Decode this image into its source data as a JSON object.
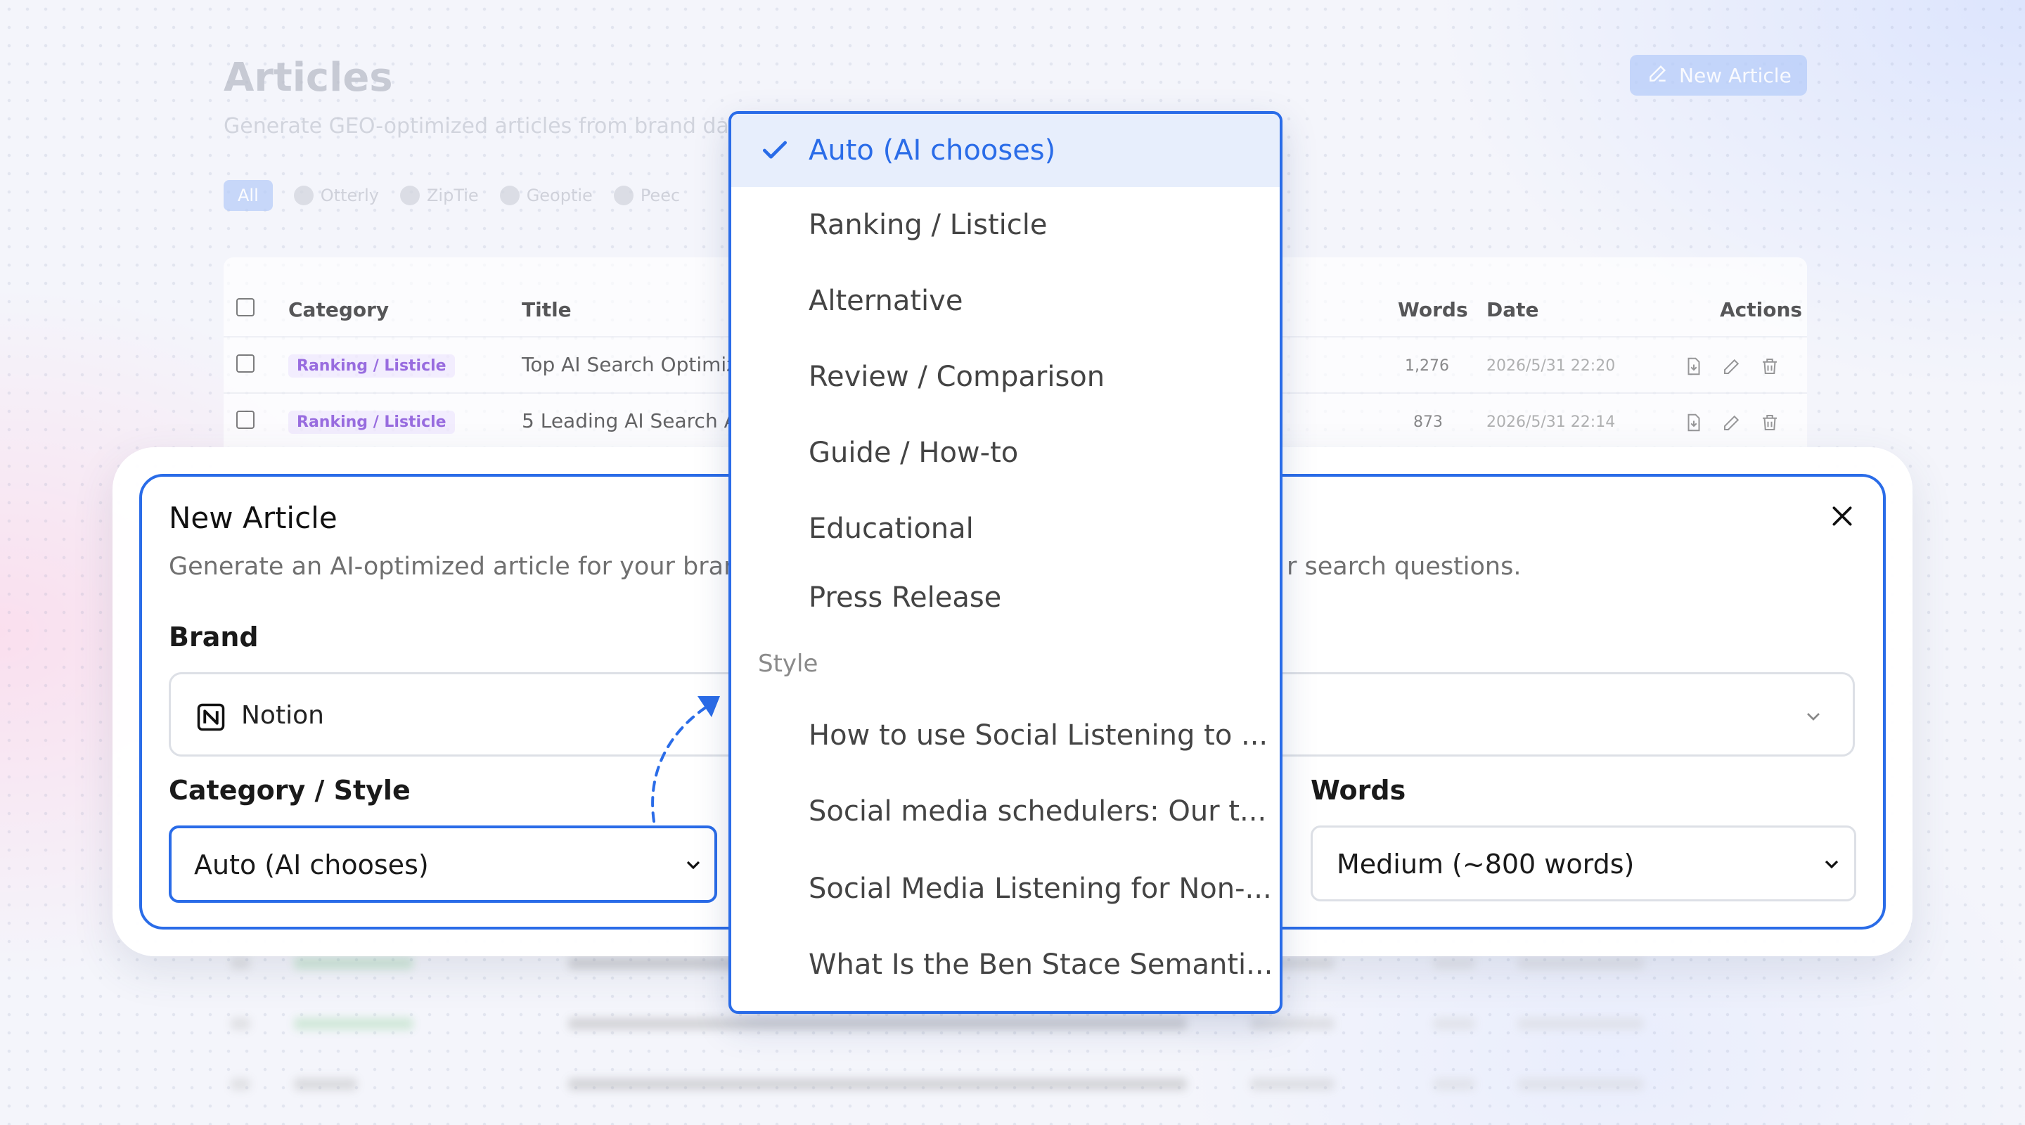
{
  "page": {
    "title": "Articles",
    "subtitle": "Generate GEO-optimized articles from brand data",
    "new_article_button": "New Article",
    "filters": {
      "all": "All",
      "items": [
        "Otterly",
        "ZipTie",
        "Geoptie",
        "Peec"
      ]
    }
  },
  "table": {
    "headers": {
      "category": "Category",
      "title": "Title",
      "words": "Words",
      "date": "Date",
      "actions": "Actions"
    },
    "rows": [
      {
        "category": "Ranking / Listicle",
        "title": "Top AI Search Optimiza",
        "words": "1,276",
        "date": "2026/5/31 22:20"
      },
      {
        "category": "Ranking / Listicle",
        "title": "5 Leading AI Search An",
        "words": "873",
        "date": "2026/5/31 22:14"
      }
    ]
  },
  "modal": {
    "title": "New Article",
    "description_left": "Generate an AI-optimized article for your bran",
    "description_right": "r search questions.",
    "brand_label": "Brand",
    "brand_value": "Notion",
    "category_label": "Category / Style",
    "category_value": "Auto (AI chooses)",
    "words_label": "Words",
    "words_value": "Medium (~800 words)"
  },
  "dropdown": {
    "selected": "Auto (AI chooses)",
    "categories": [
      "Ranking / Listicle",
      "Alternative",
      "Review / Comparison",
      "Guide / How-to",
      "Educational",
      "Press Release"
    ],
    "style_group_label": "Style",
    "styles": [
      "How to use Social Listening to ...",
      "Social media schedulers: Our t...",
      "Social Media Listening for Non-...",
      "What Is the Ben Stace Semanti..."
    ]
  },
  "colors": {
    "accent": "#2a6ce8",
    "selected_bg": "#e7eefc",
    "badge_text": "#7a3fd6",
    "badge_bg": "#f2ebff"
  }
}
